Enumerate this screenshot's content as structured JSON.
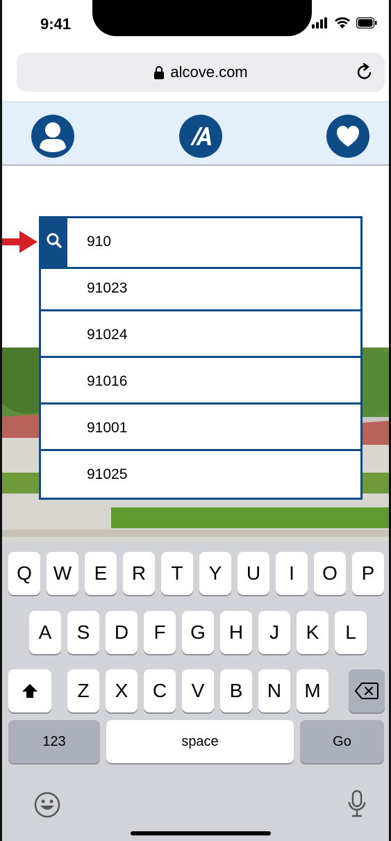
{
  "status_bar": {
    "time": "9:41"
  },
  "browser": {
    "url": "alcove.com"
  },
  "header": {
    "profile_icon": "user-icon",
    "logo_letter": "A",
    "favorite_icon": "heart-icon"
  },
  "search": {
    "value": "910",
    "suggestions": [
      "91023",
      "91024",
      "91016",
      "91001",
      "91025"
    ]
  },
  "keyboard": {
    "row1": [
      "Q",
      "W",
      "E",
      "R",
      "T",
      "Y",
      "U",
      "I",
      "O",
      "P"
    ],
    "row2": [
      "A",
      "S",
      "D",
      "F",
      "G",
      "H",
      "J",
      "K",
      "L"
    ],
    "row3": [
      "Z",
      "X",
      "C",
      "V",
      "B",
      "N",
      "M"
    ],
    "numbers_label": "123",
    "space_label": "space",
    "go_label": "Go"
  },
  "colors": {
    "brand": "#0f4b87",
    "arrow": "#d42027",
    "header_bg": "#e3effb"
  }
}
